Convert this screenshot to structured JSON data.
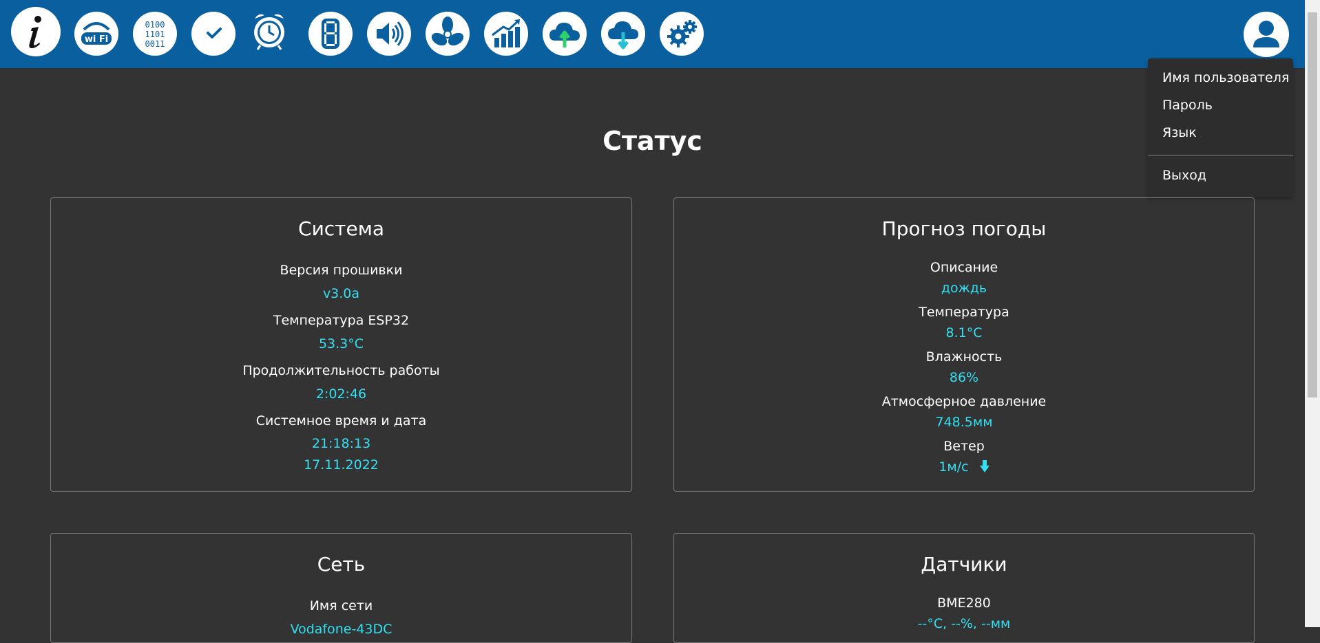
{
  "colors": {
    "topbar": "#0a5f9e",
    "background": "#333333",
    "value": "#33e0f3",
    "icon": "#0a5f9e"
  },
  "nav_icons": [
    "info-icon",
    "wifi-icon",
    "binary-icon",
    "checkmark-icon",
    "alarm-clock-icon",
    "seven-segment-display-icon",
    "speaker-icon",
    "fan-icon",
    "chart-icon",
    "cloud-upload-icon",
    "cloud-download-icon",
    "settings-gears-icon"
  ],
  "nav": {
    "wifi_text": "wi Fi",
    "binary_rows": [
      "0100",
      "1101",
      "0011"
    ]
  },
  "user_menu": {
    "icon": "user-icon",
    "items": [
      "Имя пользователя",
      "Пароль",
      "Язык"
    ],
    "logout": "Выход"
  },
  "page_title": "Статус",
  "system": {
    "title": "Система",
    "firmware_label": "Версия прошивки",
    "firmware_value": "v3.0a",
    "esp_temp_label": "Температура ESP32",
    "esp_temp_value": "53.3°C",
    "uptime_label": "Продолжительность работы",
    "uptime_value": "2:02:46",
    "datetime_label": "Системное время и дата",
    "time_value": "21:18:13",
    "date_value": "17.11.2022"
  },
  "weather": {
    "title": "Прогноз погоды",
    "description_label": "Описание",
    "description_value": "дождь",
    "temperature_label": "Температура",
    "temperature_value": "8.1°C",
    "humidity_label": "Влажность",
    "humidity_value": "86%",
    "pressure_label": "Атмосферное давление",
    "pressure_value": "748.5мм",
    "wind_label": "Ветер",
    "wind_value": "1м/с",
    "wind_direction_icon": "arrow-down-icon"
  },
  "network": {
    "title": "Сеть",
    "ssid_label": "Имя сети",
    "ssid_value": "Vodafone-43DC"
  },
  "sensors": {
    "title": "Датчики",
    "bme280_label": "BME280",
    "bme280_value": "--°C, --%, --мм"
  }
}
